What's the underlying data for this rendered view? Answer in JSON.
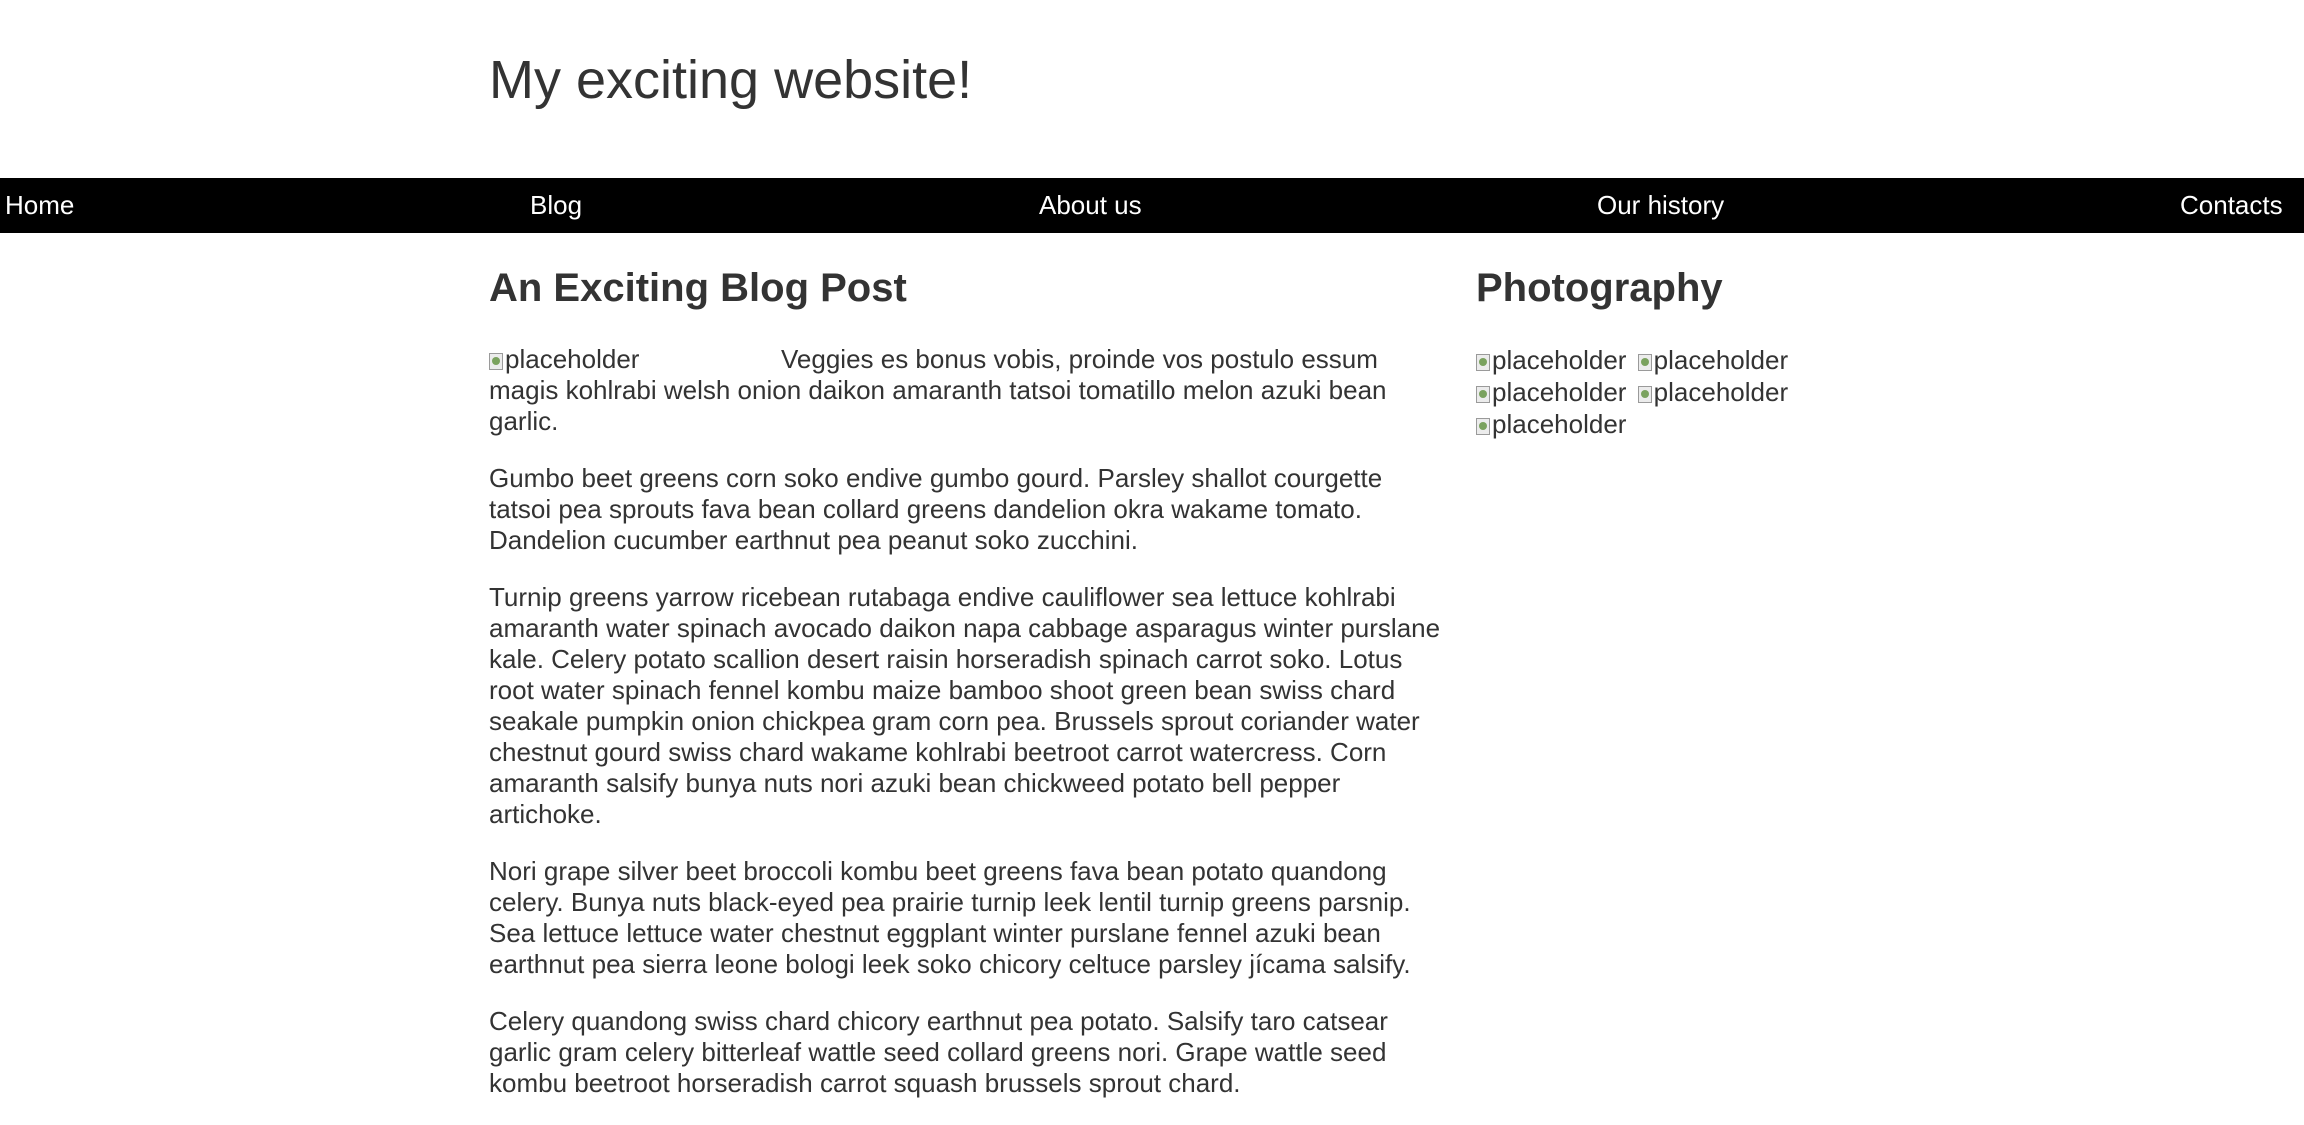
{
  "header": {
    "title": "My exciting website!"
  },
  "nav": {
    "items": [
      {
        "label": "Home"
      },
      {
        "label": "Blog"
      },
      {
        "label": "About us"
      },
      {
        "label": "Our history"
      },
      {
        "label": "Contacts"
      }
    ]
  },
  "main": {
    "heading": "An Exciting Blog Post",
    "image_alt": "placeholder",
    "paragraphs": [
      "Veggies es bonus vobis, proinde vos postulo essum magis kohlrabi welsh onion daikon amaranth tatsoi tomatillo melon azuki bean garlic.",
      "Gumbo beet greens corn soko endive gumbo gourd. Parsley shallot courgette tatsoi pea sprouts fava bean collard greens dandelion okra wakame tomato. Dandelion cucumber earthnut pea peanut soko zucchini.",
      "Turnip greens yarrow ricebean rutabaga endive cauliflower sea lettuce kohlrabi amaranth water spinach avocado daikon napa cabbage asparagus winter purslane kale. Celery potato scallion desert raisin horseradish spinach carrot soko. Lotus root water spinach fennel kombu maize bamboo shoot green bean swiss chard seakale pumpkin onion chickpea gram corn pea. Brussels sprout coriander water chestnut gourd swiss chard wakame kohlrabi beetroot carrot watercress. Corn amaranth salsify bunya nuts nori azuki bean chickweed potato bell pepper artichoke.",
      "Nori grape silver beet broccoli kombu beet greens fava bean potato quandong celery. Bunya nuts black-eyed pea prairie turnip leek lentil turnip greens parsnip. Sea lettuce lettuce water chestnut eggplant winter purslane fennel azuki bean earthnut pea sierra leone bologi leek soko chicory celtuce parsley jícama salsify.",
      "Celery quandong swiss chard chicory earthnut pea potato. Salsify taro catsear garlic gram celery bitterleaf wattle seed collard greens nori. Grape wattle seed kombu beetroot horseradish carrot squash brussels sprout chard."
    ]
  },
  "sidebar": {
    "heading": "Photography",
    "images": [
      {
        "alt": "placeholder"
      },
      {
        "alt": "placeholder"
      },
      {
        "alt": "placeholder"
      },
      {
        "alt": "placeholder"
      },
      {
        "alt": "placeholder"
      }
    ]
  }
}
